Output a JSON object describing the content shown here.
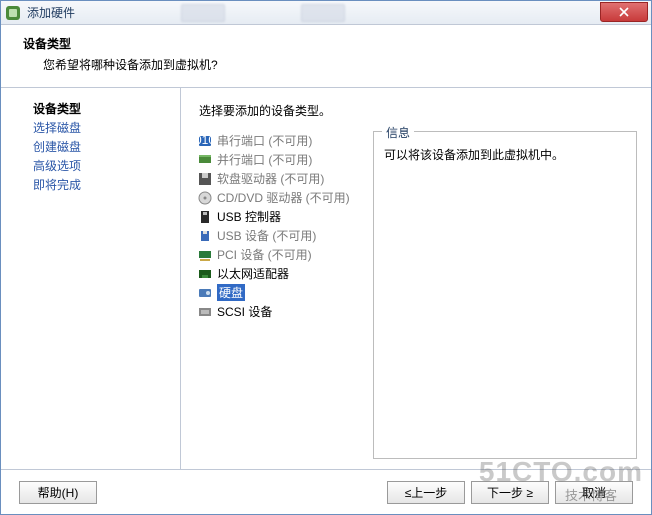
{
  "window": {
    "title": "添加硬件"
  },
  "header": {
    "title": "设备类型",
    "subtitle": "您希望将哪种设备添加到虚拟机?"
  },
  "steps": {
    "items": [
      {
        "label": "设备类型",
        "active": true
      },
      {
        "label": "选择磁盘",
        "active": false
      },
      {
        "label": "创建磁盘",
        "active": false
      },
      {
        "label": "高级选项",
        "active": false
      },
      {
        "label": "即将完成",
        "active": false
      }
    ]
  },
  "content": {
    "prompt": "选择要添加的设备类型。",
    "devices": [
      {
        "icon": "serial-port-icon",
        "label": "串行端口 (不可用)",
        "available": false,
        "selected": false
      },
      {
        "icon": "parallel-port-icon",
        "label": "并行端口 (不可用)",
        "available": false,
        "selected": false
      },
      {
        "icon": "floppy-icon",
        "label": "软盘驱动器 (不可用)",
        "available": false,
        "selected": false
      },
      {
        "icon": "cddvd-icon",
        "label": "CD/DVD 驱动器 (不可用)",
        "available": false,
        "selected": false
      },
      {
        "icon": "usb-controller-icon",
        "label": "USB 控制器",
        "available": true,
        "selected": false
      },
      {
        "icon": "usb-device-icon",
        "label": "USB 设备 (不可用)",
        "available": false,
        "selected": false
      },
      {
        "icon": "pci-device-icon",
        "label": "PCI 设备 (不可用)",
        "available": false,
        "selected": false
      },
      {
        "icon": "ethernet-icon",
        "label": "以太网适配器",
        "available": true,
        "selected": false
      },
      {
        "icon": "hard-disk-icon",
        "label": "硬盘",
        "available": true,
        "selected": true
      },
      {
        "icon": "scsi-device-icon",
        "label": "SCSI 设备",
        "available": true,
        "selected": false
      }
    ],
    "info": {
      "legend": "信息",
      "text": "可以将该设备添加到此虚拟机中。"
    }
  },
  "footer": {
    "help": "帮助(H)",
    "back": "≤上一步",
    "next": "下一步 ≥",
    "cancel": "取消"
  },
  "watermark": {
    "big": "51CTO.com",
    "small": "技术博客"
  }
}
